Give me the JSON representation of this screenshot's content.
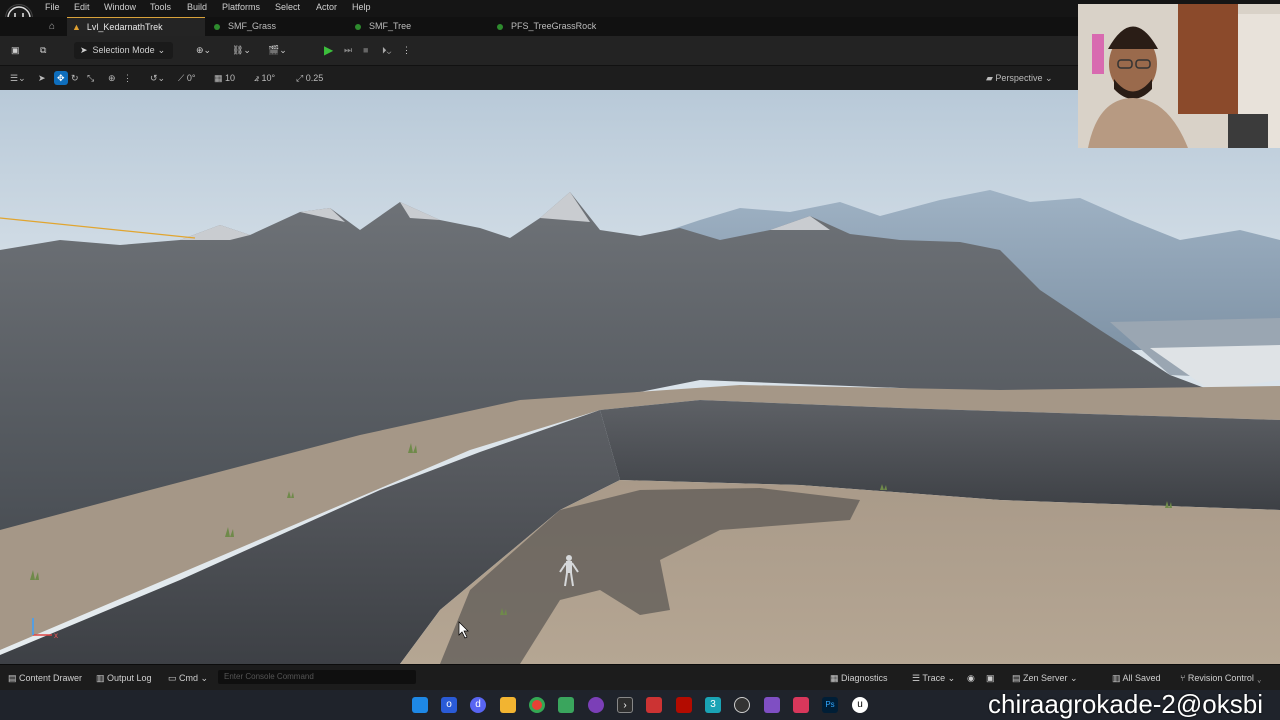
{
  "menu": {
    "items": [
      "File",
      "Edit",
      "Window",
      "Tools",
      "Build",
      "Platforms",
      "Select",
      "Actor",
      "Help"
    ]
  },
  "tabs": [
    {
      "label": "Lvl_KedarnathTrek",
      "active": true
    },
    {
      "label": "SMF_Grass",
      "active": false
    },
    {
      "label": "SMF_Tree",
      "active": false
    },
    {
      "label": "PFS_TreeGrassRock",
      "active": false
    }
  ],
  "toolbar": {
    "selection_mode_label": "Selection Mode"
  },
  "viewport_toolbar": {
    "rotation_snap": "0°",
    "grid_snap": "10",
    "angle_snap": "10°",
    "scale_snap": "0.25",
    "view_mode": "Perspective"
  },
  "bottom_bar": {
    "content_drawer": "Content Drawer",
    "output_log": "Output Log",
    "cmd": "Cmd",
    "console_placeholder": "Enter Console Command",
    "diagnostics": "Diagnostics",
    "trace": "Trace",
    "zen_server": "Zen Server",
    "all_saved": "All Saved",
    "revision_control": "Revision Control"
  },
  "overlay": {
    "text": "chiraagrokade-2@oksbi"
  },
  "colors": {
    "accent_blue": "#0e6ebd",
    "play_green": "#3cbf3c",
    "active_tab_line": "#d9a23a"
  }
}
